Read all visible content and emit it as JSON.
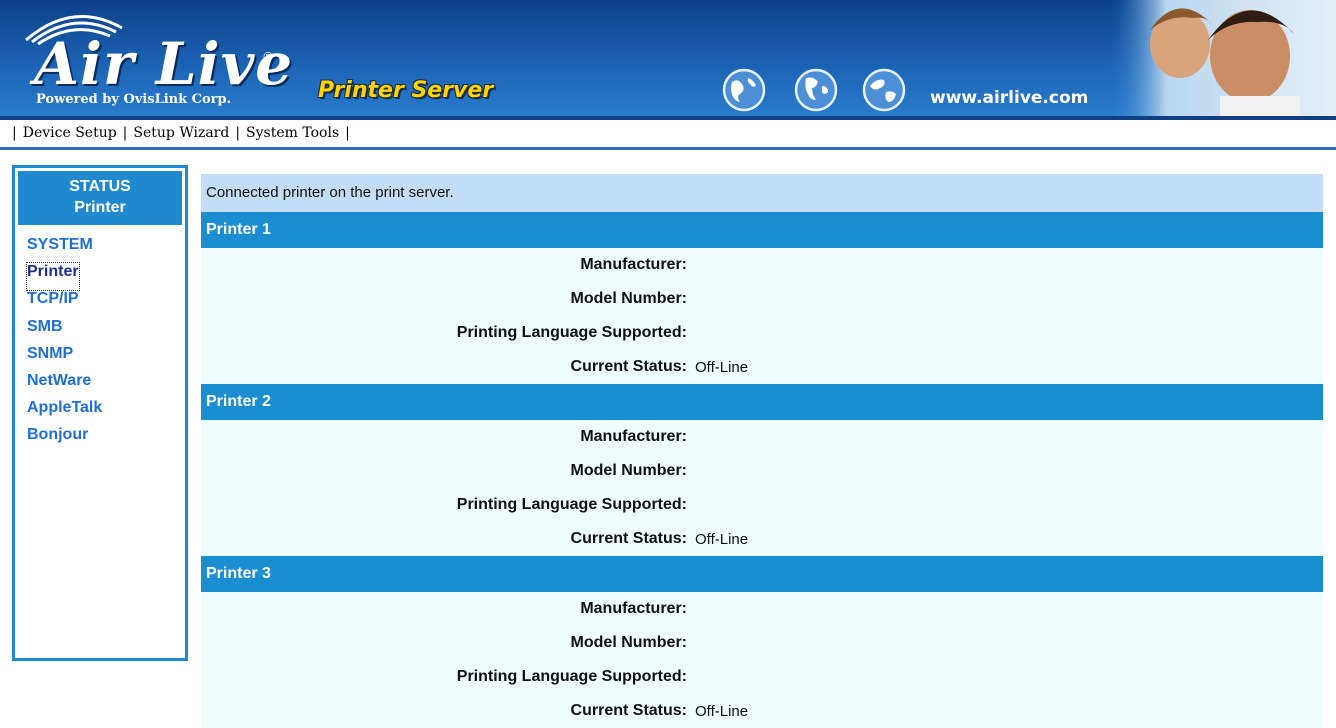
{
  "banner": {
    "logo": "Air Live",
    "powered_by": "Powered by OvisLink Corp.",
    "product": "Printer Server",
    "url": "www.airlive.com",
    "colors": {
      "banner_top": "#0d3f88",
      "banner_bottom": "#2a7bcc",
      "product_text": "#ffd400"
    }
  },
  "menu": {
    "items": [
      "Device Setup",
      "Setup Wizard",
      "System Tools"
    ]
  },
  "sidebar": {
    "header_line1": "STATUS",
    "header_line2": "Printer",
    "items": [
      "SYSTEM",
      "Printer",
      "TCP/IP",
      "SMB",
      "SNMP",
      "NetWare",
      "AppleTalk",
      "Bonjour"
    ],
    "active": "Printer",
    "colors": {
      "accent": "#1f8ad0",
      "link": "#1f6fd4"
    }
  },
  "main": {
    "caption": "Connected printer on the print server.",
    "labels": {
      "manufacturer": "Manufacturer:",
      "model": "Model Number:",
      "language": "Printing Language Supported:",
      "status": "Current Status:"
    },
    "printers": [
      {
        "title": "Printer 1",
        "manufacturer": "",
        "model": "",
        "language": "",
        "status": "Off-Line"
      },
      {
        "title": "Printer 2",
        "manufacturer": "",
        "model": "",
        "language": "",
        "status": "Off-Line"
      },
      {
        "title": "Printer 3",
        "manufacturer": "",
        "model": "",
        "language": "",
        "status": "Off-Line"
      }
    ]
  }
}
